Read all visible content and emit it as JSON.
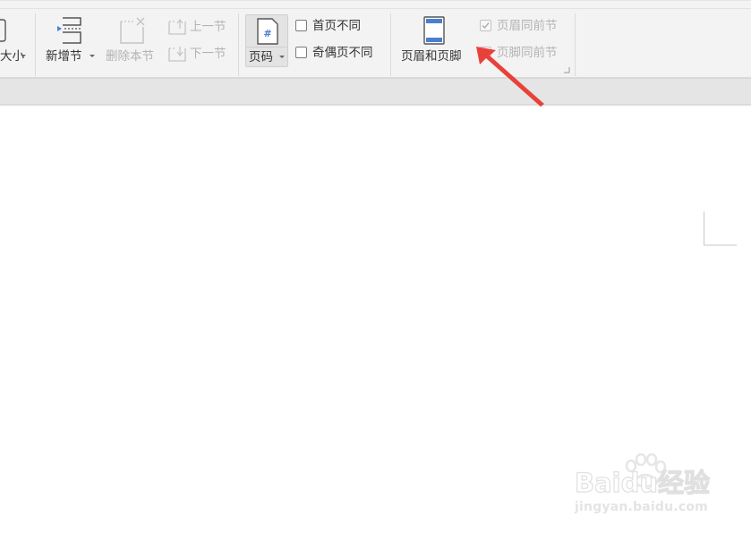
{
  "ribbon": {
    "size_button": {
      "label": "大小"
    },
    "new_section": {
      "label": "新增节"
    },
    "delete_section": {
      "label": "删除本节"
    },
    "prev_section": {
      "label": "上一节"
    },
    "next_section": {
      "label": "下一节"
    },
    "page_number": {
      "label": "页码"
    },
    "first_page_different": {
      "label": "首页不同",
      "checked": false
    },
    "odd_even_different": {
      "label": "奇偶页不同",
      "checked": false
    },
    "header_footer": {
      "label": "页眉和页脚"
    },
    "header_same_as_previous": {
      "label": "页眉同前节",
      "checked": true,
      "enabled": false
    },
    "footer_same_as_previous": {
      "label": "页脚同前节",
      "checked": true,
      "enabled": false
    }
  },
  "watermark": {
    "brand": "Baidu经验",
    "url": "jingyan.baidu.com"
  },
  "colors": {
    "annotation_arrow": "#e8413a",
    "ribbon_bg": "#f3f3f3",
    "icon_blue": "#4a7fd0"
  }
}
